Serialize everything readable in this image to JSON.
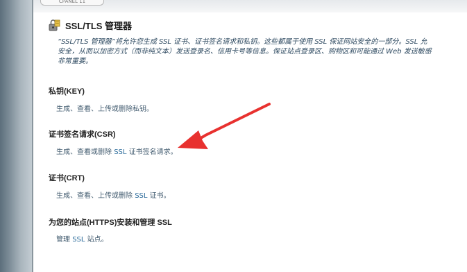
{
  "top_tab": {
    "label": "CPANEL 11"
  },
  "page_title": "SSL/TLS 管理器",
  "intro": {
    "line1": "“SSL/TLS 管理器”将允许您生成 SSL 证书、证书签名请求和私钥。这些都属于使用 SSL 保证网站安全的一部分。SSL 允",
    "line2": "安全，从而以加密方式（而非纯文本）发送登录名、信用卡号等信息。保证站点登录区、购物区和可能通过 Web 发送敏感",
    "line3": "非常重要。"
  },
  "sections": [
    {
      "title": "私钥(KEY)",
      "desc_pre": "生成、查看、上传或删除私钥。",
      "desc_link": "",
      "desc_post": ""
    },
    {
      "title": "证书签名请求(CSR)",
      "desc_pre": "生成、查看或删除 ",
      "desc_link": "SSL",
      "desc_post": " 证书签名请求。"
    },
    {
      "title": "证书(CRT)",
      "desc_pre": "生成、查看、上传或删除 ",
      "desc_link": "SSL",
      "desc_post": " 证书。"
    },
    {
      "title": "为您的站点(HTTPS)安装和管理 SSL",
      "desc_pre": "管理 ",
      "desc_link": "SSL",
      "desc_post": " 站点。"
    }
  ],
  "colors": {
    "arrow": "#e8312f",
    "intro_text": "#2d4960",
    "link_text": "#2a6a9a"
  },
  "icons": {
    "title": "ssl-lock-icon"
  }
}
